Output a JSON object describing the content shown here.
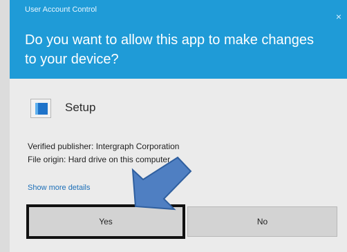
{
  "dialog": {
    "window_title": "User Account Control",
    "question": "Do you want to allow this app to make changes to your device?",
    "app_name": "Setup",
    "publisher_line": "Verified publisher: Intergraph Corporation",
    "origin_line": "File origin: Hard drive on this computer",
    "more_details_link": "Show more details",
    "yes_label": "Yes",
    "no_label": "No",
    "close_glyph": "×"
  },
  "icons": {
    "app": "setup-app-icon",
    "close": "close-icon",
    "annotation": "pointer-arrow"
  },
  "colors": {
    "header": "#1f9bd7",
    "link": "#1c6fb8",
    "button": "#d3d3d3",
    "arrow": "#4f7fc2",
    "highlight_border": "#111111"
  }
}
